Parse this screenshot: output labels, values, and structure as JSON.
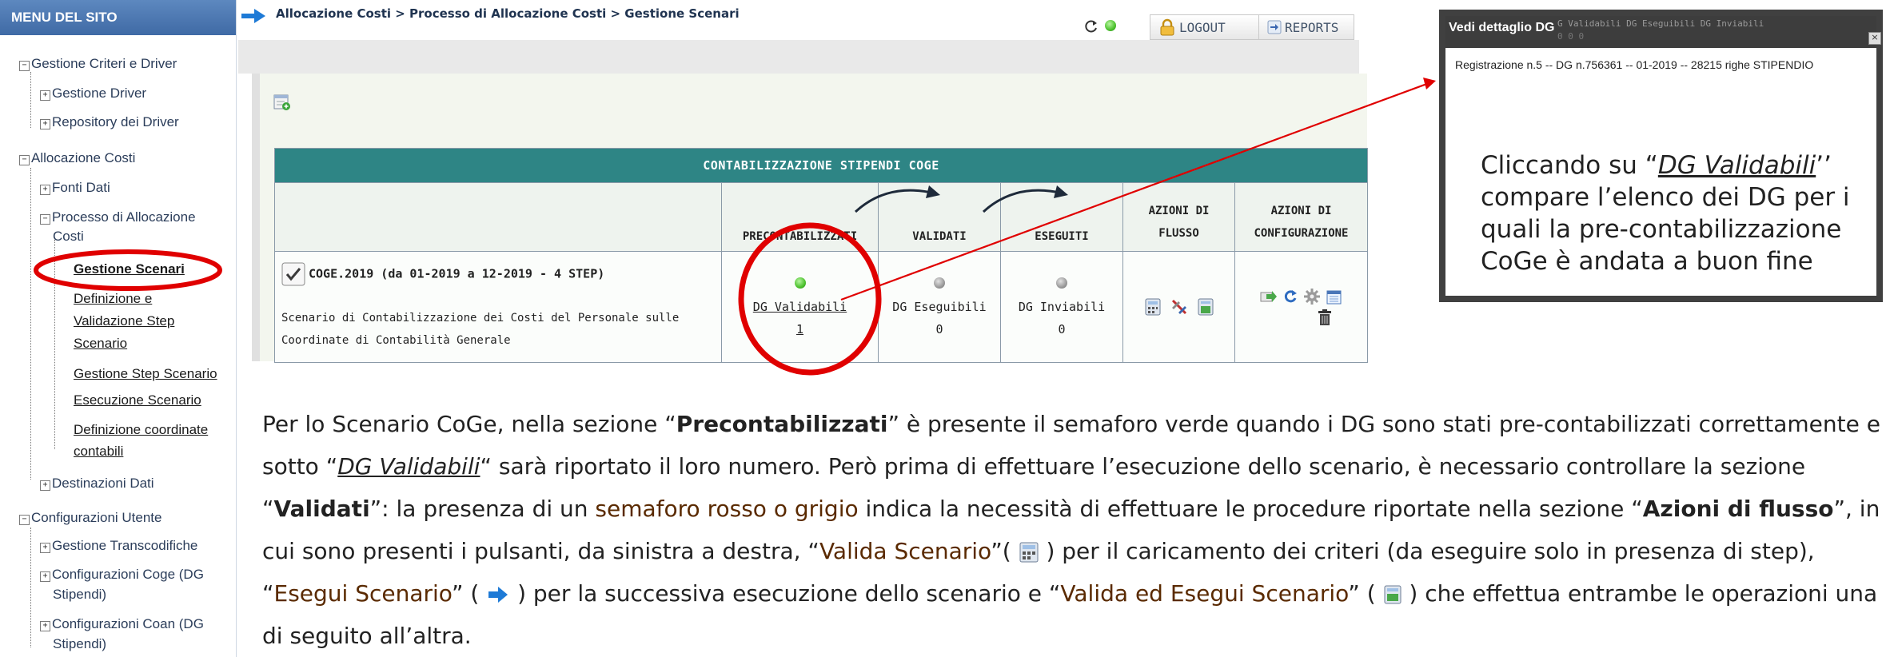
{
  "sidebar": {
    "header": "MENU DEL SITO",
    "items": {
      "gestione_criteri": "Gestione Criteri e Driver",
      "gestione_driver": "Gestione Driver",
      "repository_driver": "Repository dei Driver",
      "allocazione_costi": "Allocazione Costi",
      "fonti_dati": "Fonti Dati",
      "processo_line1": "Processo di Allocazione",
      "processo_line2": "Costi",
      "gestione_scenari": "Gestione Scenari",
      "definizione_line1": "Definizione e",
      "definizione_line2": "Validazione Step",
      "definizione_line3": "Scenario",
      "gestione_step": "Gestione Step Scenario",
      "esecuzione_scenario": "Esecuzione Scenario",
      "coordinate_line1": "Definizione coordinate",
      "coordinate_line2": "contabili",
      "destinazioni_dati": "Destinazioni Dati",
      "configurazioni_utente": "Configurazioni Utente",
      "gestione_transcodifiche": "Gestione Transcodifiche",
      "config_coge_line1": "Configurazioni Coge (DG",
      "config_coge_line2": "Stipendi)",
      "config_coan_line1": "Configurazioni Coan (DG",
      "config_coan_line2": "Stipendi)"
    }
  },
  "breadcrumb": "Allocazione Costi > Processo di Allocazione Costi > Gestione Scenari",
  "toolbar": {
    "logout_label": "LOGOUT",
    "reports_label": "REPORTS"
  },
  "table": {
    "title": "CONTABILIZZAZIONE STIPENDI COGE",
    "headers": {
      "precontabilizzati": "PRECONTABILIZZATI",
      "validati": "VALIDATI",
      "eseguiti": "ESEGUITI",
      "azioni_flusso_1": "AZIONI DI",
      "azioni_flusso_2": "FLUSSO",
      "azioni_config_1": "AZIONI DI",
      "azioni_config_2": "CONFIGURAZIONE"
    },
    "row": {
      "name": "COGE.2019 (da 01-2019 a 12-2019 - 4 STEP)",
      "desc_line1": "Scenario di Contabilizzazione dei Costi del Personale sulle",
      "desc_line2": "Coordinate di Contabilità Generale",
      "validabili_label": "DG Validabili",
      "validabili_count": "1",
      "eseguibili_label": "DG Eseguibili",
      "eseguibili_count": "0",
      "inviabili_label": "DG Inviabili",
      "inviabili_count": "0"
    }
  },
  "popup": {
    "title": "Vedi dettaglio DG",
    "ghost_headers": "G Validabili      DG Eseguibili      DG Inviabili",
    "ghost_values": "0                    0                    0",
    "record": "Registrazione n.5 -- DG n.756361 -- 01-2019 -- 28215 righe STIPENDIO",
    "note_before": "Cliccando su “",
    "note_link": "DG Validabili",
    "note_after": "’’ compare l’elenco dei DG per i quali la pre-contabilizzazione CoGe è andata a buon fine"
  },
  "explain": {
    "p1": "Per lo Scenario CoGe, nella sezione “",
    "b1": "Precontabilizzati",
    "p2": "” è presente il semaforo verde quando i DG sono stati pre-contabilizzati correttamente e sotto “",
    "u1": "DG Validabili",
    "p3": "“ sarà riportato il loro numero. Però prima di effettuare l’esecuzione dello scenario, è necessario controllare la sezione “",
    "b2": "Validati",
    "p4": "”: la presenza di un ",
    "h1": "semaforo rosso o grigio",
    "p5": " indica la necessità di effettuare le procedure riportate nella sezione “",
    "b3": "Azioni di flusso",
    "p6": "”, in cui sono presenti i pulsanti, da sinistra a destra, “",
    "h2": "Valida Scenario",
    "p7": "”( ",
    "p8": " ) per il caricamento dei criteri (da eseguire solo in presenza di step), “",
    "h3": "Esegui Scenario",
    "p9": "” ( ",
    "p10": " ) per la successiva esecuzione dello scenario e “",
    "h4": "Valida ed Esegui Scenario",
    "p11": "” ( ",
    "p12": " ) che effettua entrambe le operazioni una di seguito all’altra."
  },
  "colors": {
    "menu_header": "#3f6aa5",
    "table_title_bg": "#2e8585",
    "annotation_red": "#e00000",
    "semaforo_verde": "#4cc12d",
    "semaforo_grigio": "#9a9a9a"
  }
}
